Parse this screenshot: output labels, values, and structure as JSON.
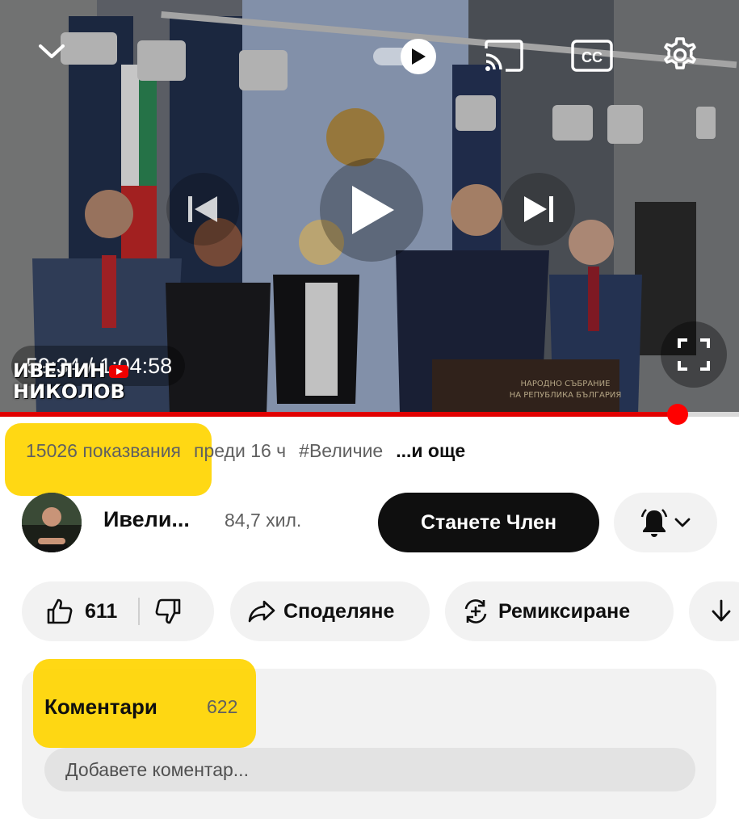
{
  "player": {
    "current_time": "59:34",
    "separator": "/",
    "duration": "1:04:58",
    "progress_fraction": 0.917,
    "watermark_line1": "ИВЕЛИН",
    "watermark_line2": "НИКОЛОВ",
    "podium_text_line1": "НАРОДНО СЪБРАНИЕ",
    "podium_text_line2": "НА РЕПУБЛИКА БЪЛГАРИЯ",
    "icons": {
      "collapse": "chevron-down-icon",
      "autoplay": "autoplay-toggle-icon",
      "cast": "cast-icon",
      "captions": "closed-captions-icon",
      "settings": "gear-icon",
      "previous": "skip-previous-icon",
      "play": "play-icon",
      "next": "skip-next-icon",
      "fullscreen": "fullscreen-icon"
    },
    "cc_label": "CC"
  },
  "meta": {
    "views": "15026 показвания",
    "age": "преди 16 ч",
    "hashtag": "#Величие",
    "more": "...и още"
  },
  "channel": {
    "name": "Ивели...",
    "subscribers": "84,7 хил.",
    "join_label": "Станете Член"
  },
  "actions": {
    "likes": "611",
    "share_label": "Споделяне",
    "remix_label": "Ремиксиране"
  },
  "comments": {
    "title": "Коментари",
    "count": "622",
    "placeholder": "Добавете коментар..."
  },
  "colors": {
    "highlight": "#ffd500",
    "progress": "#e00000",
    "join_button": "#0f0f0f",
    "pill_bg": "#f2f2f2"
  }
}
